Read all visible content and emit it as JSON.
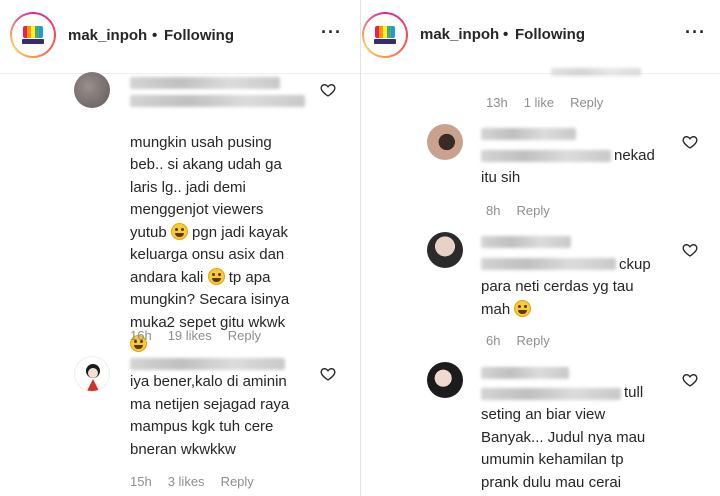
{
  "header": {
    "username": "mak_inpoh",
    "separator": "•",
    "follow_status": "Following",
    "more_glyph": "···"
  },
  "left": {
    "comments": [
      {
        "text": "mungkin usah pusing\nbeb.. si akang udah ga\nlaris lg.. jadi demi\nmenggenjot viewers\nyutub",
        "text_2": "pgn jadi kayak\nkeluarga onsu asix dan\nandara kali",
        "text_3": "tp apa\nmungkin? Secara isinya\nmuka2 sepet gitu wkwk",
        "time": "16h",
        "likes": "19 likes",
        "reply": "Reply"
      },
      {
        "text": "iya bener,kalo di aminin\nma netijen sejagad raya\nmampus kgk tuh cere\nbneran wkwkkw",
        "time": "15h",
        "likes": "3 likes",
        "reply": "Reply"
      }
    ]
  },
  "right": {
    "top_meta": {
      "time": "13h",
      "likes": "1 like",
      "reply": "Reply"
    },
    "comments": [
      {
        "text_inline": "nekad",
        "text": "itu sih",
        "time": "8h",
        "reply": "Reply"
      },
      {
        "text_inline": "ckup",
        "text": "para neti cerdas yg tau\nmah",
        "time": "6h",
        "reply": "Reply"
      },
      {
        "text_inline": "tull",
        "text": "seting an biar view\nBanyak... Judul nya mau\numumin kehamilan tp\nprank dulu mau cerai"
      }
    ]
  },
  "colors": {
    "text": "#262626",
    "meta": "#8e8e8e",
    "divider": "#e2e2e2"
  }
}
